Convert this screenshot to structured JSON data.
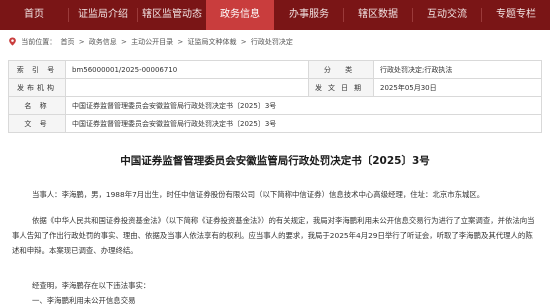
{
  "nav": {
    "items": [
      "首页",
      "证监局介绍",
      "辖区监管动态",
      "政务信息",
      "办事服务",
      "辖区数据",
      "互动交流",
      "专题专栏"
    ],
    "active_index": 3
  },
  "breadcrumb": {
    "label": "当前位置：",
    "items": [
      "首页",
      "政务信息",
      "主动公开目录",
      "证监局文种体裁",
      "行政处罚决定"
    ],
    "separator": ">"
  },
  "info": {
    "index_label": "索 引 号",
    "index_value": "bm56000001/2025-00006710",
    "category_label": "分 类",
    "category_value": "行政处罚决定;行政执法",
    "publisher_label": "发布机构",
    "publisher_value": "",
    "date_label": "发文日期",
    "date_value": "2025年05月30日",
    "name_label": "名 称",
    "name_value": "中国证券监督管理委员会安徽监管局行政处罚决定书〔2025〕3号",
    "docno_label": "文 号",
    "docno_value": "中国证券监督管理委员会安徽监管局行政处罚决定书〔2025〕3号"
  },
  "document": {
    "title": "中国证券监督管理委员会安徽监管局行政处罚决定书〔2025〕3号",
    "p1": "当事人：李海鹏，男，1988年7月出生，时任中信证券股份有限公司（以下简称中信证券）信息技术中心高级经理，住址：北京市东城区。",
    "p2": "依据《中华人民共和国证券投资基金法》（以下简称《证券投资基金法》）的有关规定，我局对李海鹏利用未公开信息交易行为进行了立案调查，并依法向当事人告知了作出行政处罚的事实、理由、依据及当事人依法享有的权利。应当事人的要求，我局于2025年4月29日举行了听证会，听取了李海鹏及其代理人的陈述和申辩。本案现已调查、办理终结。",
    "p3": "经查明，李海鹏存在以下违法事实：",
    "p4": "一、李海鹏利用未公开信息交易"
  },
  "colors": {
    "nav_bg": "#7a1516",
    "nav_active": "#c93d3d"
  }
}
